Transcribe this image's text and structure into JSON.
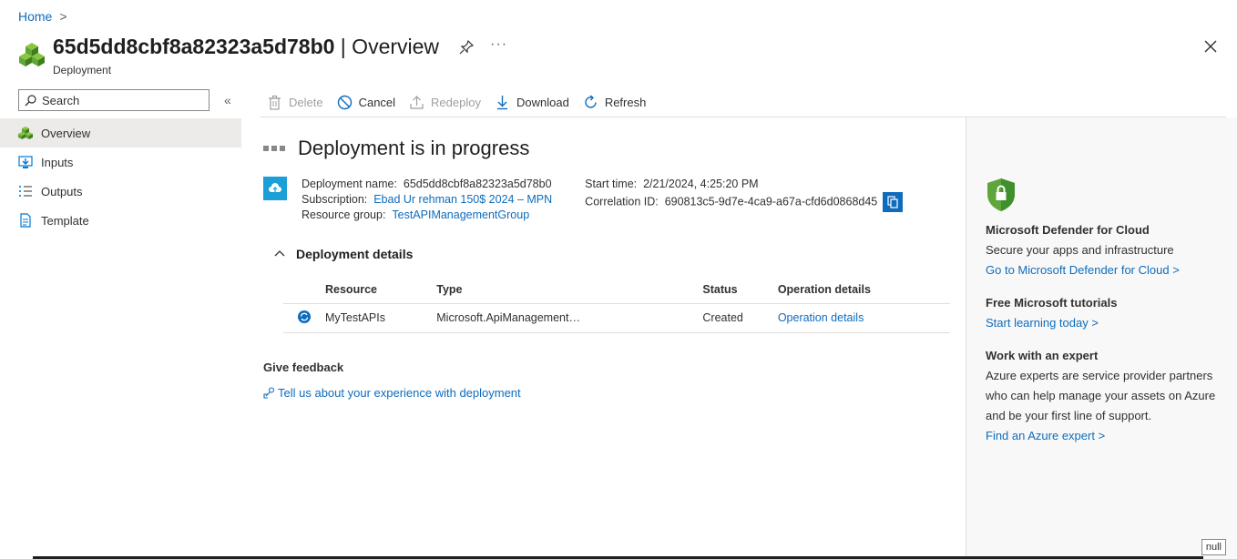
{
  "breadcrumb": {
    "home": "Home",
    "sep": ">"
  },
  "header": {
    "resource_id": "65d5dd8cbf8a82323a5d78b0",
    "title_suffix": " | Overview",
    "subtitle": "Deployment",
    "more": "···"
  },
  "sidebar": {
    "search_placeholder": "Search",
    "collapse": "«",
    "items": [
      {
        "label": "Overview",
        "icon": "deployment-icon",
        "active": true
      },
      {
        "label": "Inputs",
        "icon": "inputs-icon"
      },
      {
        "label": "Outputs",
        "icon": "outputs-icon"
      },
      {
        "label": "Template",
        "icon": "template-icon"
      }
    ]
  },
  "toolbar": {
    "delete": "Delete",
    "cancel": "Cancel",
    "redeploy": "Redeploy",
    "download": "Download",
    "refresh": "Refresh"
  },
  "main": {
    "status_title": "Deployment is in progress",
    "deployment_name_label": "Deployment name:",
    "deployment_name": "65d5dd8cbf8a82323a5d78b0",
    "subscription_label": "Subscription:",
    "subscription": "Ebad Ur rehman 150$ 2024 – MPN",
    "resource_group_label": "Resource group:",
    "resource_group": "TestAPIManagementGroup",
    "start_time_label": "Start time:",
    "start_time": "2/21/2024, 4:25:20 PM",
    "correlation_label": "Correlation ID:",
    "correlation_id": "690813c5-9d7e-4ca9-a67a-cfd6d0868d45",
    "details_title": "Deployment details",
    "table": {
      "headers": [
        "Resource",
        "Type",
        "Status",
        "Operation details"
      ],
      "rows": [
        {
          "resource": "MyTestAPIs",
          "type": "Microsoft.ApiManagement…",
          "status": "Created",
          "operation": "Operation details"
        }
      ]
    },
    "feedback_title": "Give feedback",
    "feedback_link": "Tell us about your experience with deployment"
  },
  "right_panel": {
    "defender_title": "Microsoft Defender for Cloud",
    "defender_text": "Secure your apps and infrastructure",
    "defender_link": "Go to Microsoft Defender for Cloud >",
    "tutorials_title": "Free Microsoft tutorials",
    "tutorials_link": "Start learning today >",
    "expert_title": "Work with an expert",
    "expert_text_1": "Azure experts are service provider partners",
    "expert_text_2": "who can help manage your assets on Azure",
    "expert_text_3": "and be your first line of support.",
    "expert_link": "Find an Azure expert >"
  },
  "badge": "null",
  "colors": {
    "accent": "#0f6cbd",
    "cloud_tile": "#1a9fd6",
    "green": "#5ea53a"
  }
}
